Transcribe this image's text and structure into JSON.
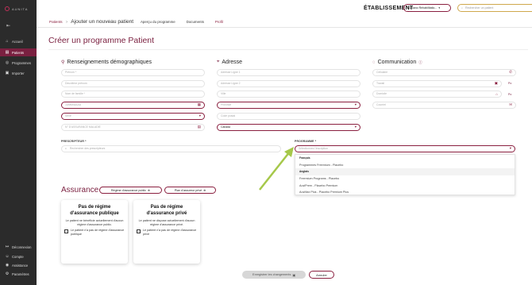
{
  "brand": {
    "logo_text": "AUNITA"
  },
  "sidebar": {
    "collapse_icon": "collapse-icon",
    "items": [
      {
        "label": "Accueil",
        "icon": "home-icon",
        "glyph": "⌂"
      },
      {
        "label": "Patients",
        "icon": "patients-icon",
        "glyph": "▤"
      },
      {
        "label": "Programmes",
        "icon": "programs-icon",
        "glyph": "◎"
      },
      {
        "label": "Importer",
        "icon": "import-icon",
        "glyph": "▣"
      }
    ],
    "bottom": [
      {
        "label": "Déconnexion",
        "glyph": "↦"
      },
      {
        "label": "Compte",
        "glyph": "☺"
      },
      {
        "label": "Assistance",
        "glyph": "◉"
      },
      {
        "label": "Paramètres",
        "glyph": "⚙"
      }
    ]
  },
  "breadcrumb": {
    "link": "Patients",
    "separator": ">",
    "current": "Ajouter un nouveau patient"
  },
  "tabs": [
    "Aperçu du programme",
    "Documents",
    "Profil"
  ],
  "header": {
    "etablissement": "ÉTABLISSEMENT",
    "etab_value": "Romano Rehabilitatio...",
    "search_placeholder": "Rechercher un patient"
  },
  "page": {
    "title": "Créer un programme Patient"
  },
  "demo": {
    "title": "Renseignements démographiques",
    "prenom": "Prénom *",
    "deuxieme": "Deuxième prénom",
    "nom": "Nom de famille *",
    "date": "JJ/MM/AAAA",
    "sexe": "Sexe",
    "assurance": "N° D'ASSURANCE MALADIE"
  },
  "adresse": {
    "title": "Adresse",
    "l1": "Adresse Ligne 1",
    "l2": "Adresse Ligne 2",
    "ville": "Ville",
    "province": "Province",
    "code": "Code postal",
    "pays": "Canada"
  },
  "comm": {
    "title": "Communication",
    "cellulaire": "Cellulaire",
    "travail": "Travail",
    "domicile": "Domicile",
    "courriel": "Courriel",
    "poste": "Po"
  },
  "prescripteur": {
    "label": "PRESCRIPTEUR *",
    "placeholder": "Rechercher des prescripteurs"
  },
  "programme": {
    "label": "PROGRAMME *",
    "placeholder": "Sélectionnez l'inscription",
    "groups": [
      {
        "name": "Français",
        "options": [
          "Programmes Freemium - Placebo"
        ]
      },
      {
        "name": "Anglais",
        "options": [
          "Freemium Programs - Placebo",
          "AuviPrem - Placebo Premium",
          "AuvMax Plus - Placebo Premium Plus"
        ]
      }
    ]
  },
  "assurance": {
    "title": "Assurance",
    "public_btn": "Régime d'assurance public",
    "private_btn": "Plan d'assureur privé",
    "cards": [
      {
        "title": "Pas de régime d'assurance publique",
        "text": "Le patient ne bénéficie actuellement d'aucun régime d'assurance public.",
        "check": "Le patient n'a pas de régime d'assurance publique"
      },
      {
        "title": "Pas de régime d'assurance privé",
        "text": "Le patient ne dispose actuellement d'aucun régime d'assurance privé.",
        "check": "Le patient n'a pas de régime d'assurance privé"
      }
    ]
  },
  "footer": {
    "save": "Enregistrer les changements",
    "cancel": "Annuler"
  },
  "colors": {
    "accent": "#8a1f3f",
    "sidebar": "#2b2b2b",
    "arrow": "#a6c84a"
  }
}
